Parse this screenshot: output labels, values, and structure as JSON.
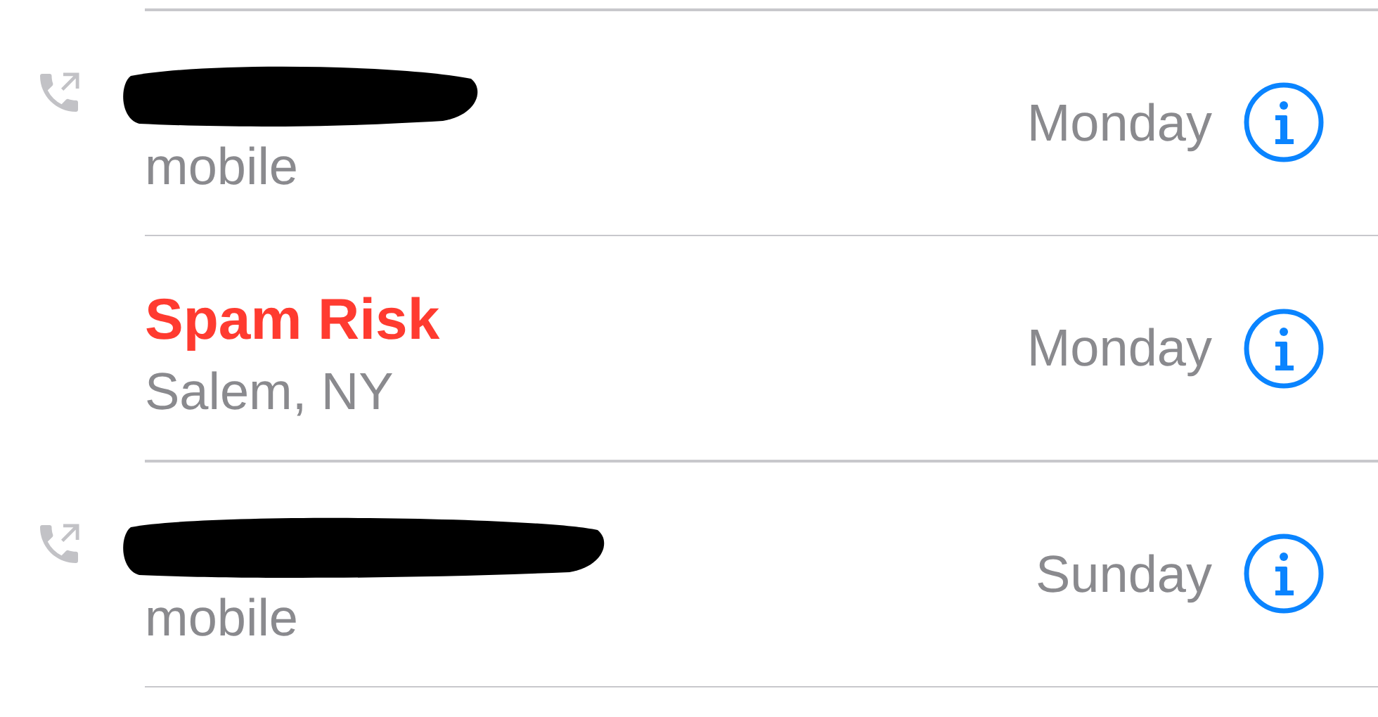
{
  "calls": [
    {
      "kind": "redacted",
      "outgoing": true,
      "subtitle": "mobile",
      "date": "Monday"
    },
    {
      "kind": "spam",
      "outgoing": false,
      "title": "Spam Risk",
      "subtitle": "Salem, NY",
      "date": "Monday"
    },
    {
      "kind": "redacted",
      "outgoing": true,
      "subtitle": "mobile",
      "date": "Sunday"
    }
  ]
}
